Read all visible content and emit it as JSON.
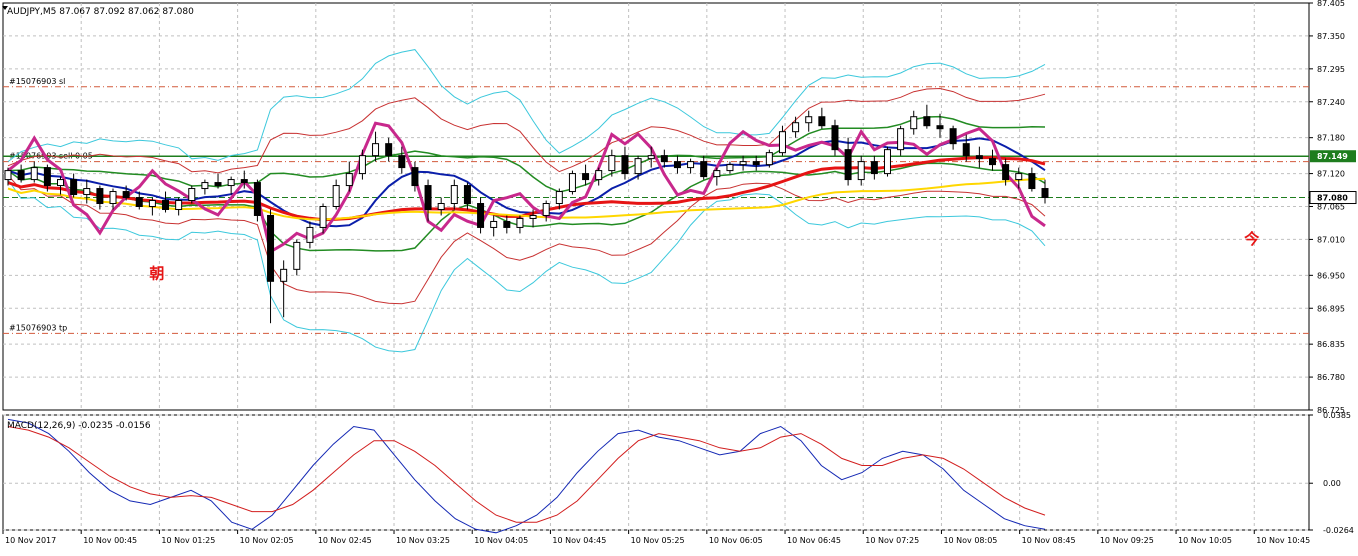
{
  "window": {
    "symbol_info": "AUDJPY,M5  87.067 87.092 87.062 87.080",
    "macd_info": "MACD(12,26,9) -0.0235 -0.0156"
  },
  "colors": {
    "background": "#ffffff",
    "grid": "#c0c0c0",
    "candle_up": "#ffffff",
    "candle_down": "#000000",
    "rsi_line": "#c8288c",
    "ma_blue": "#0a1eaa",
    "ma_red": "#e61414",
    "ma_yellow": "#ffd700",
    "bb_inner_green": "#228b22",
    "bb_middle_red": "#c83232",
    "bb_outer_cyan": "#3cc8dc",
    "sl_tp_line": "#d25a3c",
    "price_line_green": "#1e7d1e",
    "macd_main": "#1428b4",
    "macd_signal": "#d21e1e"
  },
  "chart_data": [
    {
      "type": "candlestick",
      "symbol": "AUDJPY",
      "timeframe": "M5",
      "ohlc_header": {
        "open": 87.067,
        "high": 87.092,
        "low": 87.062,
        "close": 87.08
      },
      "y_ticks": [
        "87.405",
        "87.350",
        "87.295",
        "87.240",
        "87.180",
        "87.120",
        "87.065",
        "87.010",
        "86.950",
        "86.895",
        "86.835",
        "86.780",
        "86.725"
      ],
      "ylim": [
        86.725,
        87.405
      ],
      "x_ticks": [
        "10 Nov 2017",
        "10 Nov 00:45",
        "10 Nov 01:25",
        "10 Nov 02:05",
        "10 Nov 02:45",
        "10 Nov 03:25",
        "10 Nov 04:05",
        "10 Nov 04:45",
        "10 Nov 05:25",
        "10 Nov 06:05",
        "10 Nov 06:45",
        "10 Nov 07:25",
        "10 Nov 08:05",
        "10 Nov 08:45",
        "10 Nov 09:25",
        "10 Nov 10:05",
        "10 Nov 10:45"
      ],
      "levels": [
        {
          "label": "#15076903 sl",
          "price": 87.265,
          "style": "dash-dot"
        },
        {
          "label": "#15076903 sell 0.05",
          "price": 87.14,
          "style": "dash-dot"
        },
        {
          "label": "#15076903 tp",
          "price": 86.853,
          "style": "dash-dot"
        },
        {
          "label": "87.149",
          "price": 87.149,
          "style": "solid"
        }
      ],
      "current_price_label": "87.080",
      "current_price": 87.08,
      "annotations": [
        {
          "text": "朝",
          "near_time": "10 Nov 01:25",
          "price": 86.955
        },
        {
          "text": "今",
          "near_time": "10 Nov 10:45",
          "price": 87.012
        }
      ],
      "ohlc": [
        [
          87.11,
          87.13,
          87.1,
          87.125
        ],
        [
          87.125,
          87.135,
          87.105,
          87.11
        ],
        [
          87.11,
          87.14,
          87.105,
          87.13
        ],
        [
          87.13,
          87.135,
          87.09,
          87.1
        ],
        [
          87.1,
          87.115,
          87.085,
          87.11
        ],
        [
          87.11,
          87.12,
          87.08,
          87.085
        ],
        [
          87.085,
          87.11,
          87.07,
          87.095
        ],
        [
          87.095,
          87.1,
          87.06,
          87.07
        ],
        [
          87.07,
          87.095,
          87.06,
          87.09
        ],
        [
          87.09,
          87.1,
          87.075,
          87.08
        ],
        [
          87.08,
          87.09,
          87.06,
          87.065
        ],
        [
          87.065,
          87.08,
          87.05,
          87.075
        ],
        [
          87.075,
          87.09,
          87.055,
          87.06
        ],
        [
          87.06,
          87.08,
          87.05,
          87.075
        ],
        [
          87.075,
          87.1,
          87.07,
          87.095
        ],
        [
          87.095,
          87.11,
          87.085,
          87.105
        ],
        [
          87.105,
          87.12,
          87.095,
          87.1
        ],
        [
          87.1,
          87.115,
          87.085,
          87.11
        ],
        [
          87.11,
          87.125,
          87.095,
          87.105
        ],
        [
          87.105,
          87.11,
          87.04,
          87.05
        ],
        [
          87.05,
          87.06,
          86.87,
          86.94
        ],
        [
          86.94,
          86.975,
          86.88,
          86.96
        ],
        [
          86.96,
          87.01,
          86.95,
          87.005
        ],
        [
          87.005,
          87.04,
          86.995,
          87.03
        ],
        [
          87.03,
          87.07,
          87.02,
          87.065
        ],
        [
          87.065,
          87.11,
          87.06,
          87.1
        ],
        [
          87.1,
          87.14,
          87.09,
          87.12
        ],
        [
          87.12,
          87.16,
          87.11,
          87.15
        ],
        [
          87.15,
          87.19,
          87.14,
          87.17
        ],
        [
          87.17,
          87.18,
          87.14,
          87.15
        ],
        [
          87.15,
          87.165,
          87.12,
          87.13
        ],
        [
          87.13,
          87.14,
          87.09,
          87.1
        ],
        [
          87.1,
          87.11,
          87.04,
          87.06
        ],
        [
          87.06,
          87.08,
          87.05,
          87.07
        ],
        [
          87.07,
          87.11,
          87.06,
          87.1
        ],
        [
          87.1,
          87.105,
          87.06,
          87.07
        ],
        [
          87.07,
          87.08,
          87.02,
          87.03
        ],
        [
          87.03,
          87.05,
          87.015,
          87.04
        ],
        [
          87.04,
          87.05,
          87.02,
          87.03
        ],
        [
          87.03,
          87.05,
          87.02,
          87.045
        ],
        [
          87.045,
          87.06,
          87.03,
          87.05
        ],
        [
          87.05,
          87.075,
          87.04,
          87.07
        ],
        [
          87.07,
          87.095,
          87.06,
          87.09
        ],
        [
          87.09,
          87.125,
          87.085,
          87.12
        ],
        [
          87.12,
          87.135,
          87.1,
          87.11
        ],
        [
          87.11,
          87.13,
          87.1,
          87.125
        ],
        [
          87.125,
          87.16,
          87.115,
          87.15
        ],
        [
          87.15,
          87.165,
          87.11,
          87.12
        ],
        [
          87.12,
          87.15,
          87.11,
          87.145
        ],
        [
          87.145,
          87.165,
          87.13,
          87.15
        ],
        [
          87.15,
          87.16,
          87.13,
          87.14
        ],
        [
          87.14,
          87.15,
          87.12,
          87.13
        ],
        [
          87.13,
          87.145,
          87.12,
          87.14
        ],
        [
          87.14,
          87.15,
          87.11,
          87.115
        ],
        [
          87.115,
          87.13,
          87.1,
          87.125
        ],
        [
          87.125,
          87.14,
          87.12,
          87.135
        ],
        [
          87.135,
          87.15,
          87.125,
          87.14
        ],
        [
          87.14,
          87.15,
          87.125,
          87.135
        ],
        [
          87.135,
          87.16,
          87.13,
          87.155
        ],
        [
          87.155,
          87.2,
          87.15,
          87.19
        ],
        [
          87.19,
          87.215,
          87.18,
          87.205
        ],
        [
          87.205,
          87.225,
          87.19,
          87.215
        ],
        [
          87.215,
          87.23,
          87.195,
          87.2
        ],
        [
          87.2,
          87.21,
          87.15,
          87.16
        ],
        [
          87.16,
          87.18,
          87.1,
          87.11
        ],
        [
          87.11,
          87.15,
          87.1,
          87.14
        ],
        [
          87.14,
          87.15,
          87.11,
          87.12
        ],
        [
          87.12,
          87.165,
          87.115,
          87.16
        ],
        [
          87.16,
          87.2,
          87.15,
          87.195
        ],
        [
          87.195,
          87.225,
          87.185,
          87.215
        ],
        [
          87.215,
          87.235,
          87.195,
          87.2
        ],
        [
          87.2,
          87.22,
          87.18,
          87.195
        ],
        [
          87.195,
          87.2,
          87.16,
          87.17
        ],
        [
          87.17,
          87.185,
          87.14,
          87.15
        ],
        [
          87.15,
          87.165,
          87.13,
          87.145
        ],
        [
          87.145,
          87.16,
          87.125,
          87.135
        ],
        [
          87.135,
          87.145,
          87.1,
          87.11
        ],
        [
          87.11,
          87.13,
          87.095,
          87.12
        ],
        [
          87.12,
          87.13,
          87.09,
          87.095
        ],
        [
          87.095,
          87.11,
          87.07,
          87.08
        ]
      ],
      "overlays": [
        "bollinger_bands_inner",
        "bollinger_bands_middle",
        "bollinger_bands_outer",
        "moving_average_blue",
        "moving_average_red",
        "moving_average_yellow",
        "rsi_overlay_magenta"
      ]
    },
    {
      "type": "line",
      "title": "MACD(12,26,9)",
      "values_header": {
        "main": -0.0235,
        "signal": -0.0156
      },
      "y_ticks": [
        "0.0385",
        "0.00",
        "-0.0264"
      ],
      "ylim": [
        -0.0264,
        0.0385
      ],
      "series": [
        {
          "name": "MACD",
          "values": [
            0.036,
            0.034,
            0.028,
            0.018,
            0.006,
            -0.004,
            -0.01,
            -0.012,
            -0.008,
            -0.004,
            -0.01,
            -0.022,
            -0.026,
            -0.018,
            -0.004,
            0.01,
            0.022,
            0.032,
            0.03,
            0.016,
            0.002,
            -0.01,
            -0.02,
            -0.026,
            -0.028,
            -0.024,
            -0.018,
            -0.008,
            0.006,
            0.018,
            0.028,
            0.03,
            0.026,
            0.024,
            0.02,
            0.016,
            0.018,
            0.028,
            0.032,
            0.024,
            0.01,
            0.002,
            0.006,
            0.014,
            0.018,
            0.016,
            0.008,
            -0.004,
            -0.012,
            -0.02,
            -0.024,
            -0.026
          ]
        },
        {
          "name": "Signal",
          "values": [
            0.032,
            0.03,
            0.026,
            0.02,
            0.012,
            0.004,
            -0.002,
            -0.006,
            -0.008,
            -0.007,
            -0.008,
            -0.012,
            -0.016,
            -0.016,
            -0.012,
            -0.004,
            0.006,
            0.016,
            0.024,
            0.024,
            0.018,
            0.01,
            0.0,
            -0.01,
            -0.018,
            -0.022,
            -0.022,
            -0.018,
            -0.01,
            0.002,
            0.014,
            0.024,
            0.028,
            0.026,
            0.024,
            0.02,
            0.018,
            0.02,
            0.026,
            0.028,
            0.022,
            0.014,
            0.01,
            0.01,
            0.014,
            0.016,
            0.014,
            0.008,
            0.0,
            -0.008,
            -0.014,
            -0.018
          ]
        }
      ]
    }
  ]
}
